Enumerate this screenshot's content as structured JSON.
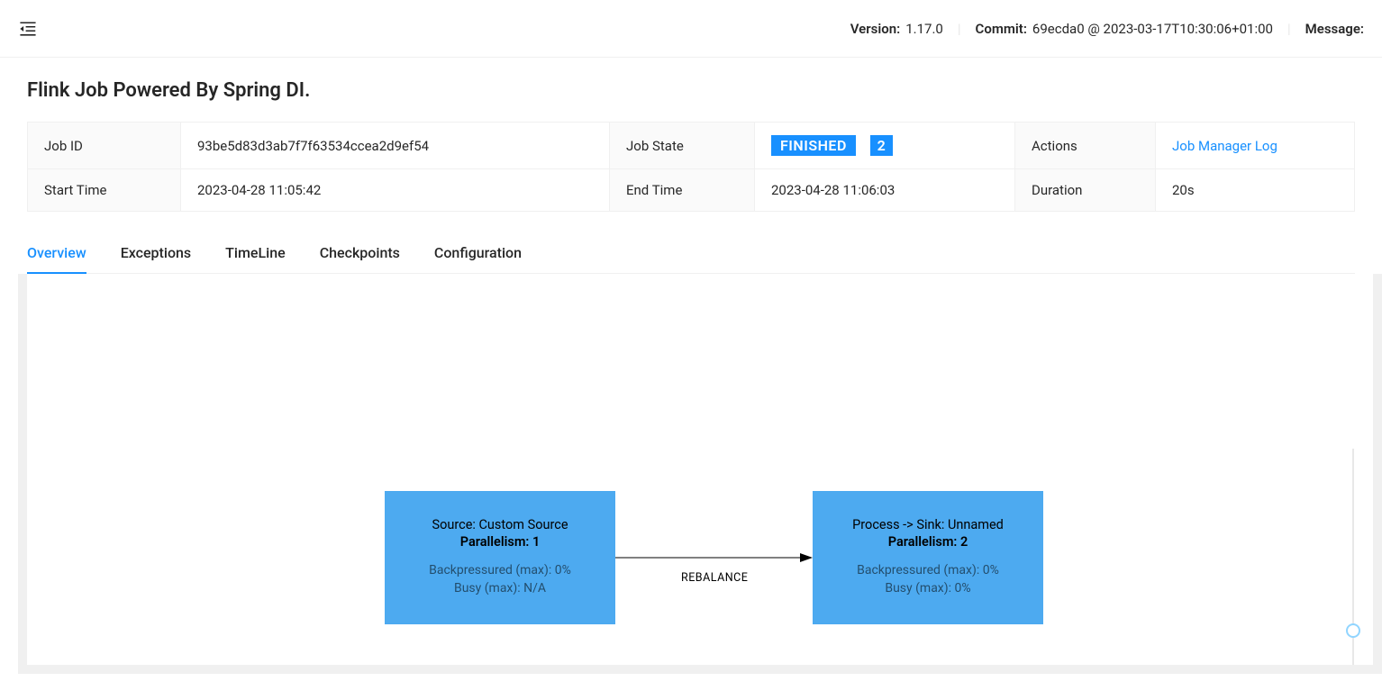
{
  "header": {
    "version_label": "Version:",
    "version_value": "1.17.0",
    "commit_label": "Commit:",
    "commit_value": "69ecda0 @ 2023-03-17T10:30:06+01:00",
    "message_label": "Message:"
  },
  "page": {
    "title": "Flink Job Powered By Spring DI."
  },
  "jobinfo": {
    "job_id_label": "Job ID",
    "job_id_value": "93be5d83d3ab7f7f63534ccea2d9ef54",
    "job_state_label": "Job State",
    "job_state_value": "FINISHED",
    "job_state_count": "2",
    "actions_label": "Actions",
    "actions_link": "Job Manager Log",
    "start_time_label": "Start Time",
    "start_time_value": "2023-04-28 11:05:42",
    "end_time_label": "End Time",
    "end_time_value": "2023-04-28 11:06:03",
    "duration_label": "Duration",
    "duration_value": "20s"
  },
  "tabs": {
    "overview": "Overview",
    "exceptions": "Exceptions",
    "timeline": "TimeLine",
    "checkpoints": "Checkpoints",
    "configuration": "Configuration"
  },
  "graph": {
    "nodes": [
      {
        "title": "Source: Custom Source",
        "parallelism": "Parallelism: 1",
        "backpressure": "Backpressured (max): 0%",
        "busy": "Busy (max): N/A"
      },
      {
        "title": "Process -> Sink: Unnamed",
        "parallelism": "Parallelism: 2",
        "backpressure": "Backpressured (max): 0%",
        "busy": "Busy (max): 0%"
      }
    ],
    "edge_label": "REBALANCE"
  }
}
